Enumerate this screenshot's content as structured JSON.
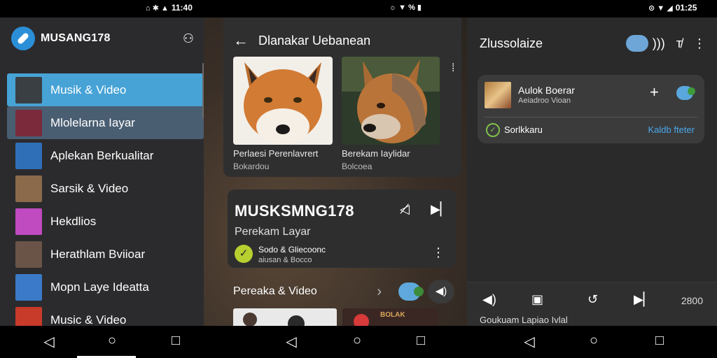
{
  "status_bar": {
    "left": {
      "icons": "⌂ ✱ ▲",
      "time": "11:40"
    },
    "middle": {
      "icons": "☼ ▼ % ▮"
    },
    "right": {
      "icons": "⊙ ▼ ◢",
      "time": "01:25"
    }
  },
  "screen1": {
    "title": "MUSANG178",
    "header_icon": "account-switch-icon",
    "menu": [
      {
        "label": "Musik & Video",
        "state": "active",
        "thumb_color": "#3a3f44"
      },
      {
        "label": "Mlolelarna Iayar",
        "state": "selected",
        "thumb_color": "#7a2a3a"
      },
      {
        "label": "Aplekan Berkualitar",
        "state": "normal",
        "thumb_color": "#2f6fb8"
      },
      {
        "label": "Sarsik & Video",
        "state": "normal",
        "thumb_color": "#8a6a4a"
      },
      {
        "label": "Hekdlios",
        "state": "normal",
        "thumb_color": "#c04ac0"
      },
      {
        "label": "Herathlam Bviioar",
        "state": "normal",
        "thumb_color": "#6a5448"
      },
      {
        "label": "Mopn Laye Ideatta",
        "state": "normal",
        "thumb_color": "#3a7ac8"
      },
      {
        "label": "Music & Video",
        "state": "normal",
        "thumb_color": "#c83a2a"
      }
    ],
    "colors": {
      "active": "#47a3d6",
      "selected": "#4a5e72"
    }
  },
  "screen2": {
    "title": "Dlanakar Uebanean",
    "cards": [
      {
        "caption": "Perlaesi Perenlavrert",
        "sub": "Bokardou"
      },
      {
        "caption": "Berekam Iaylidar",
        "sub": "Bolcoea"
      }
    ],
    "player": {
      "title": "MUSKSMNG178",
      "subtitle": "Perekam Layar",
      "line1": "Sodo & Gliecoonc",
      "line2": "aiusan & Bocco"
    },
    "row_label": "Pereaka & Video",
    "strip_label": "BOLAK"
  },
  "screen3": {
    "title": "Zlussolaize",
    "card": {
      "title": "Aulok Boerar",
      "subtitle": "Aeiadroo Vioan",
      "footer_label": "Sorlkkaru",
      "footer_link": "Kaldb fteter"
    },
    "bottom": {
      "time": "2800",
      "caption": "Goukuam Lapiao Ivlal"
    }
  }
}
